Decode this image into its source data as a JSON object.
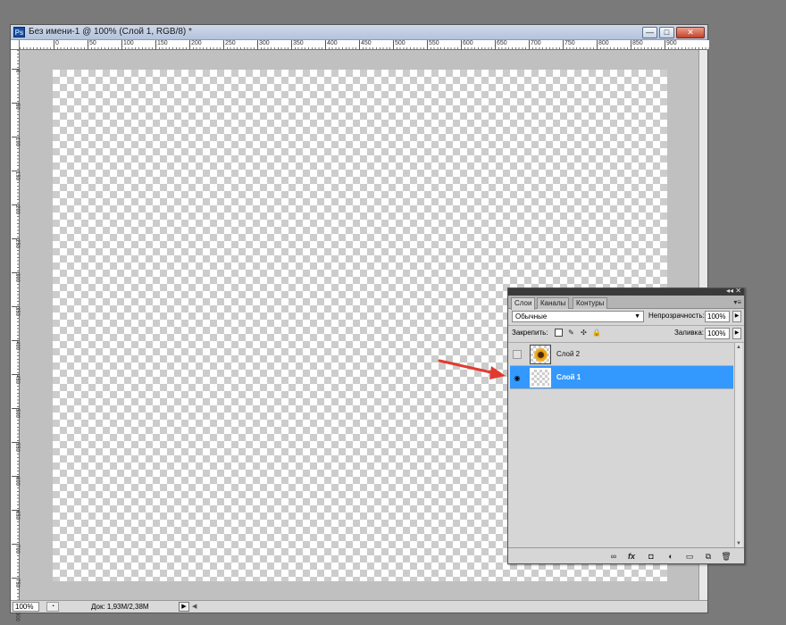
{
  "document": {
    "title": "Без имени-1 @ 100% (Слой 1, RGB/8) *",
    "app_badge": "Ps",
    "buttons": {
      "minimize": "—",
      "maximize": "□",
      "close": "✕"
    }
  },
  "rulers": {
    "horizontal": [
      "0",
      "50",
      "100",
      "150",
      "200",
      "250",
      "300",
      "350",
      "400",
      "450",
      "500",
      "550",
      "600",
      "650",
      "700",
      "750",
      "800",
      "850",
      "900"
    ],
    "vertical": [
      "0",
      "50",
      "100",
      "150",
      "200",
      "250",
      "300",
      "350",
      "400",
      "450",
      "500",
      "550",
      "600",
      "650",
      "700",
      "750",
      "800"
    ]
  },
  "statusbar": {
    "zoom": "100%",
    "doc_info": "Док: 1,93M/2,38M",
    "arrow": "▶",
    "scroll_left": "◀"
  },
  "layers_panel": {
    "tabs": [
      "Слои",
      "Каналы",
      "Контуры"
    ],
    "active_tab": "Слои",
    "panel_top_icons": "◂◂ ✕",
    "menu_icon": "▾≡",
    "blend_mode": "Обычные",
    "opacity_label": "Непрозрачность:",
    "opacity_value": "100%",
    "lock_label": "Закрепить:",
    "fill_label": "Заливка:",
    "fill_value": "100%",
    "layers": [
      {
        "name": "Слой 2",
        "visible": false,
        "selected": false,
        "thumbnail": "sunflower"
      },
      {
        "name": "Слой 1",
        "visible": true,
        "selected": true,
        "thumbnail": "transparent"
      }
    ],
    "eye_glyph": "◉",
    "bottom_icons": [
      "link-icon",
      "fx-icon",
      "mask-icon",
      "adjustment-icon",
      "group-icon",
      "new-layer-icon",
      "trash-icon"
    ],
    "bottom_glyphs": [
      "∞",
      "fx",
      "◘",
      "◐",
      "▭",
      "⧉",
      "🗑"
    ]
  },
  "colors": {
    "selection": "#3399ff",
    "arrow": "#e03a2f"
  }
}
